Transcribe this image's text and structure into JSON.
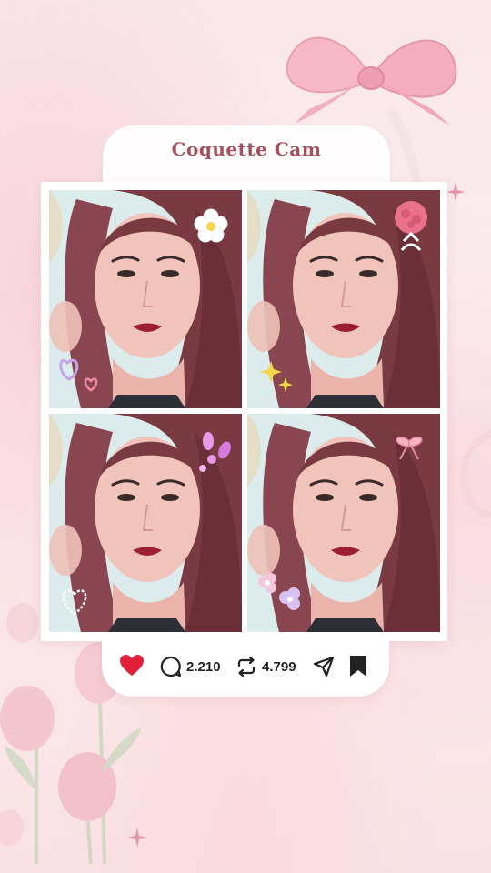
{
  "card": {
    "title": "Coquette Cam"
  },
  "photos": [
    {
      "sticker": "flower-icon"
    },
    {
      "sticker": "rose-bouquet-icon"
    },
    {
      "sticker": "pink-bubbles-icon"
    },
    {
      "sticker": "bow-icon"
    }
  ],
  "actions": {
    "like": {
      "icon": "heart-icon",
      "liked": true,
      "color": "#e0203a"
    },
    "comments": {
      "icon": "comment-icon",
      "count": "2.210"
    },
    "reposts": {
      "icon": "repost-icon",
      "count": "4.799"
    },
    "share": {
      "icon": "send-icon"
    },
    "save": {
      "icon": "bookmark-icon",
      "saved": true
    }
  },
  "colors": {
    "title": "#a9505d",
    "background": "#f9e6e9",
    "accent_pink": "#f2a9b8"
  }
}
